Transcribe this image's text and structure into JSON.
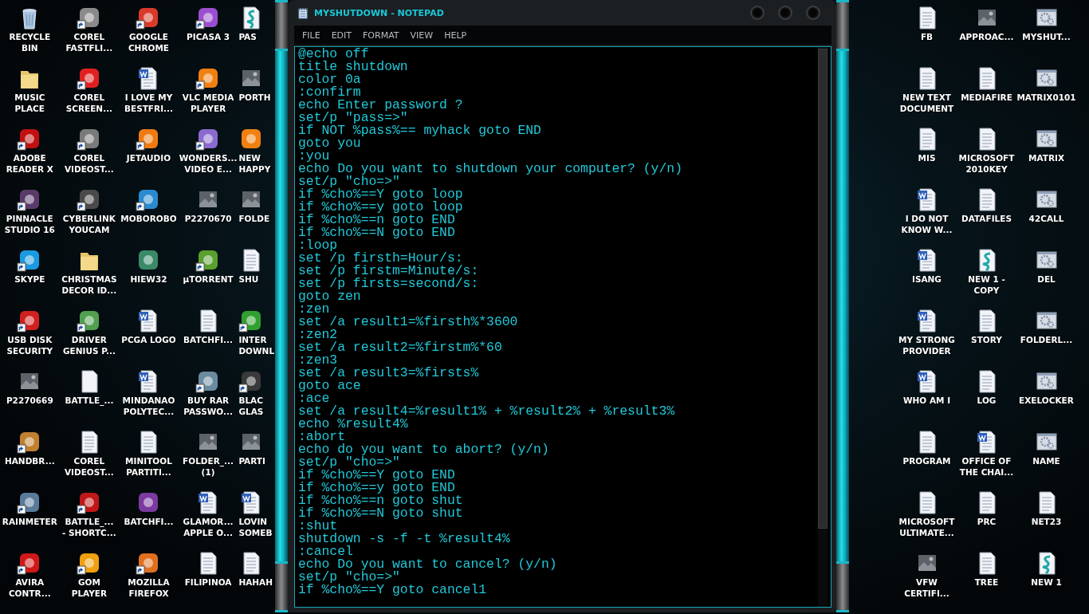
{
  "desktop_left": [
    {
      "label": "RECYCLE\nBIN",
      "kind": "recycle",
      "shortcut": false
    },
    {
      "label": "COREL\nFASTFLI...",
      "kind": "app",
      "color": "#8a8a8a",
      "shortcut": true
    },
    {
      "label": "GOOGLE\nCHROME",
      "kind": "app",
      "color": "#d93a2b",
      "shortcut": true
    },
    {
      "label": "PICASA 3",
      "kind": "app",
      "color": "#9a4fd0",
      "shortcut": true
    },
    {
      "label": "PAS",
      "kind": "script",
      "shortcut": false
    },
    {
      "label": "MUSIC\nPLACE",
      "kind": "folder",
      "shortcut": false
    },
    {
      "label": "COREL\nSCREEN...",
      "kind": "app",
      "color": "#e02020",
      "shortcut": true
    },
    {
      "label": "I LOVE MY\nBESTFRI...",
      "kind": "word",
      "shortcut": false
    },
    {
      "label": "VLC MEDIA\nPLAYER",
      "kind": "app",
      "color": "#f08010",
      "shortcut": true
    },
    {
      "label": "PORTH",
      "kind": "image",
      "shortcut": false
    },
    {
      "label": "ADOBE\nREADER X",
      "kind": "app",
      "color": "#c01010",
      "shortcut": true
    },
    {
      "label": "COREL\nVIDEOST...",
      "kind": "app",
      "color": "#7a7a7a",
      "shortcut": true
    },
    {
      "label": "JETAUDIO",
      "kind": "app",
      "color": "#f07a10",
      "shortcut": true
    },
    {
      "label": "WONDERS...\nVIDEO E...",
      "kind": "app",
      "color": "#8a6ad0",
      "shortcut": true
    },
    {
      "label": "NEW\nHAPPY",
      "kind": "app",
      "color": "#f08010",
      "shortcut": false
    },
    {
      "label": "PINNACLE\nSTUDIO 16",
      "kind": "app",
      "color": "#5a3a6a",
      "shortcut": true
    },
    {
      "label": "CYBERLINK\nYOUCAM",
      "kind": "app",
      "color": "#4a4a4a",
      "shortcut": true
    },
    {
      "label": "MOBOROBO",
      "kind": "app",
      "color": "#2a8ad0",
      "shortcut": true
    },
    {
      "label": "P2270670",
      "kind": "image",
      "shortcut": false
    },
    {
      "label": "FOLDE",
      "kind": "image",
      "shortcut": false
    },
    {
      "label": "SKYPE",
      "kind": "app",
      "color": "#1a9ae0",
      "shortcut": true
    },
    {
      "label": "CHRISTMAS\nDECOR ID...",
      "kind": "folder",
      "shortcut": false
    },
    {
      "label": "HIEW32",
      "kind": "app",
      "color": "#3a8a6a",
      "shortcut": false
    },
    {
      "label": "µTORRENT",
      "kind": "app",
      "color": "#5aa030",
      "shortcut": true
    },
    {
      "label": "SHU",
      "kind": "text",
      "shortcut": false
    },
    {
      "label": "USB DISK\nSECURITY",
      "kind": "app",
      "color": "#d02020",
      "shortcut": true
    },
    {
      "label": "DRIVER\nGENIUS P...",
      "kind": "app",
      "color": "#50a050",
      "shortcut": true
    },
    {
      "label": "PCGA LOGO",
      "kind": "word",
      "shortcut": false
    },
    {
      "label": "BATCHFI...",
      "kind": "text",
      "shortcut": false
    },
    {
      "label": "INTER\nDOWNL",
      "kind": "app",
      "color": "#30a030",
      "shortcut": true
    },
    {
      "label": "P2270669",
      "kind": "image",
      "shortcut": false
    },
    {
      "label": "BATTLE_...",
      "kind": "blank",
      "shortcut": false
    },
    {
      "label": "MINDANAO\nPOLYTEC...",
      "kind": "word",
      "shortcut": false
    },
    {
      "label": "BUY RAR\nPASSWO...",
      "kind": "app",
      "color": "#6a8aa0",
      "shortcut": true
    },
    {
      "label": "BLAC\nGLAS",
      "kind": "app",
      "color": "#3a3a3a",
      "shortcut": true
    },
    {
      "label": "HANDBR...",
      "kind": "app",
      "color": "#c08030",
      "shortcut": true
    },
    {
      "label": "COREL\nVIDEOST...",
      "kind": "text",
      "shortcut": false
    },
    {
      "label": "MINITOOL\nPARTITI...",
      "kind": "text",
      "shortcut": false
    },
    {
      "label": "FOLDER_...\n(1)",
      "kind": "image",
      "shortcut": false
    },
    {
      "label": "PARTI",
      "kind": "image",
      "shortcut": false
    },
    {
      "label": "RAINMETER",
      "kind": "app",
      "color": "#5a7a9a",
      "shortcut": true
    },
    {
      "label": "BATTLE_...\n- SHORTC...",
      "kind": "app",
      "color": "#c01818",
      "shortcut": true
    },
    {
      "label": "BATCHFI...",
      "kind": "app",
      "color": "#7a3aa0",
      "shortcut": false
    },
    {
      "label": "GLAMOR...\nAPPLE O...",
      "kind": "word",
      "shortcut": false
    },
    {
      "label": "LOVIN\nSOMEB",
      "kind": "word",
      "shortcut": false
    },
    {
      "label": "AVIRA\nCONTR...",
      "kind": "app",
      "color": "#d01818",
      "shortcut": true
    },
    {
      "label": "GOM\nPLAYER",
      "kind": "app",
      "color": "#f0a010",
      "shortcut": true
    },
    {
      "label": "MOZILLA\nFIREFOX",
      "kind": "app",
      "color": "#e07020",
      "shortcut": true
    },
    {
      "label": "FILIPINOA",
      "kind": "text",
      "shortcut": false
    },
    {
      "label": "HAHAH",
      "kind": "text",
      "shortcut": false
    }
  ],
  "window": {
    "title": "MYSHUTDOWN - NOTEPAD",
    "menu": [
      "FILE",
      "EDIT",
      "FORMAT",
      "VIEW",
      "HELP"
    ],
    "lines": [
      "@echo off",
      "title shutdown",
      "color 0a",
      ":confirm",
      "echo Enter password ?",
      "set/p \"pass=>\"",
      "if NOT %pass%== myhack goto END",
      "goto you",
      ":you",
      "echo Do you want to shutdown your computer? (y/n)",
      "set/p \"cho=>\"",
      "if %cho%==Y goto loop",
      "if %cho%==y goto loop",
      "if %cho%==n goto END",
      "if %cho%==N goto END",
      ":loop",
      "set /p firsth=Hour/s:",
      "set /p firstm=Minute/s:",
      "set /p firsts=second/s:",
      "goto zen",
      ":zen",
      "set /a result1=%firsth%*3600",
      ":zen2",
      "set /a result2=%firstm%*60",
      ":zen3",
      "set /a result3=%firsts%",
      "goto ace",
      ":ace",
      "set /a result4=%result1% + %result2% + %result3%",
      "echo %result4%",
      ":abort",
      "echo do you want to abort? (y/n)",
      "set/p \"cho=>\"",
      "if %cho%==Y goto END",
      "if %cho%==y goto END",
      "if %cho%==n goto shut",
      "if %cho%==N goto shut",
      ":shut",
      "shutdown -s -f -t %result4%",
      ":cancel",
      "echo Do you want to cancel? (y/n)",
      "set/p \"cho=>\"",
      "if %cho%==Y goto cancel1"
    ]
  },
  "desktop_right": [
    {
      "label": "FB",
      "kind": "text",
      "shortcut": false
    },
    {
      "label": "APPROAC...",
      "kind": "image",
      "shortcut": false
    },
    {
      "label": "MYSHUT...",
      "kind": "bat",
      "shortcut": false
    },
    {
      "label": "NEW TEXT\nDOCUMENT",
      "kind": "text",
      "shortcut": false
    },
    {
      "label": "MEDIAFIRE",
      "kind": "text",
      "shortcut": false
    },
    {
      "label": "MATRIX0101",
      "kind": "bat",
      "shortcut": false
    },
    {
      "label": "MIS",
      "kind": "text",
      "shortcut": false
    },
    {
      "label": "MICROSOFT\n2010KEY",
      "kind": "text",
      "shortcut": false
    },
    {
      "label": "MATRIX",
      "kind": "bat",
      "shortcut": false
    },
    {
      "label": "I DO NOT\nKNOW W...",
      "kind": "word",
      "shortcut": false
    },
    {
      "label": "DATAFILES",
      "kind": "text",
      "shortcut": false
    },
    {
      "label": "42CALL",
      "kind": "bat",
      "shortcut": false
    },
    {
      "label": "ISANG",
      "kind": "word",
      "shortcut": false
    },
    {
      "label": "NEW 1 -\nCOPY",
      "kind": "script",
      "shortcut": false
    },
    {
      "label": "DEL",
      "kind": "bat",
      "shortcut": false
    },
    {
      "label": "MY STRONG\nPROVIDER",
      "kind": "word",
      "shortcut": false
    },
    {
      "label": "STORY",
      "kind": "text",
      "shortcut": false
    },
    {
      "label": "FOLDERL...",
      "kind": "bat",
      "shortcut": false
    },
    {
      "label": "WHO AM I",
      "kind": "word",
      "shortcut": false
    },
    {
      "label": "LOG",
      "kind": "text",
      "shortcut": false
    },
    {
      "label": "EXELOCKER",
      "kind": "bat",
      "shortcut": false
    },
    {
      "label": "PROGRAM",
      "kind": "text",
      "shortcut": false
    },
    {
      "label": "OFFICE OF\nTHE CHAI...",
      "kind": "word",
      "shortcut": false
    },
    {
      "label": "NAME",
      "kind": "bat",
      "shortcut": false
    },
    {
      "label": "MICROSOFT\nULTIMATE...",
      "kind": "text",
      "shortcut": false
    },
    {
      "label": "PRC",
      "kind": "text",
      "shortcut": false
    },
    {
      "label": "NET23",
      "kind": "text",
      "shortcut": false
    },
    {
      "label": "VFW\nCERTIFI...",
      "kind": "image",
      "shortcut": false
    },
    {
      "label": "TREE",
      "kind": "text",
      "shortcut": false
    },
    {
      "label": "NEW 1",
      "kind": "script",
      "shortcut": false
    }
  ]
}
